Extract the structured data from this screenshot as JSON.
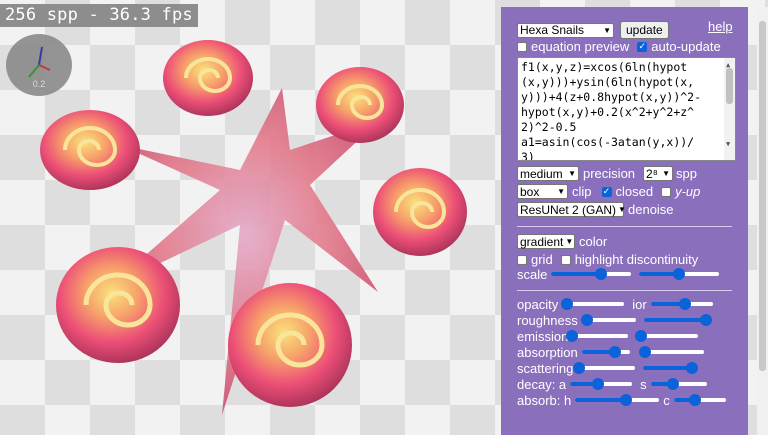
{
  "overlay": {
    "fps_text": "256 spp - 36.3 fps",
    "gizmo_value": "0.2"
  },
  "panel": {
    "preset": "Hexa Snails",
    "update_label": "update",
    "help_label": "help",
    "equation_preview": {
      "label": "equation preview",
      "checked": false
    },
    "auto_update": {
      "label": "auto-update",
      "checked": true
    },
    "equation_lines": [
      "f1(x,y,z)=xcos(6ln(hypot",
      "(x,y)))+ysin(6ln(hypot(x,",
      "y)))+4(z+0.8hypot(x,y))^2-",
      "hypot(x,y)+0.2(x^2+y^2+z^",
      "2)^2-0.5",
      "a1=asin(cos(-3atan(y,x))/",
      "3)"
    ],
    "quality": {
      "value": "medium",
      "label": "precision",
      "spp_value": "2⁸",
      "spp_label": "spp"
    },
    "clip": {
      "value": "box",
      "label": "clip",
      "closed": {
        "label": "closed",
        "checked": true
      },
      "yup": {
        "label": "y-up",
        "checked": false
      }
    },
    "denoise": {
      "value": "ResUNet 2 (GAN)",
      "label": "denoise"
    },
    "color": {
      "value": "gradient",
      "label": "color"
    },
    "grid": {
      "label": "grid",
      "checked": false
    },
    "highlight": {
      "label": "highlight discontinuity",
      "checked": false
    },
    "scale": {
      "label": "scale",
      "value1": 0.62,
      "value2": 0.5
    },
    "sliders": [
      {
        "label": "opacity",
        "value": 0.08,
        "label2": "ior",
        "value2": 0.55
      },
      {
        "label": "roughness",
        "value": 0.1,
        "value2": 1.0
      },
      {
        "label": "emission",
        "value": 0.0,
        "value2": 0.05
      },
      {
        "label": "absorption",
        "value": 0.7,
        "value2": 0.05
      },
      {
        "label": "scattering",
        "value": 0.03,
        "value2": 0.9
      },
      {
        "label": "decay: a",
        "value": 0.45,
        "label2": "s",
        "value2": 0.4
      },
      {
        "label": "absorb: h",
        "value": 0.6,
        "label2": "c",
        "value2": 0.4
      }
    ]
  }
}
